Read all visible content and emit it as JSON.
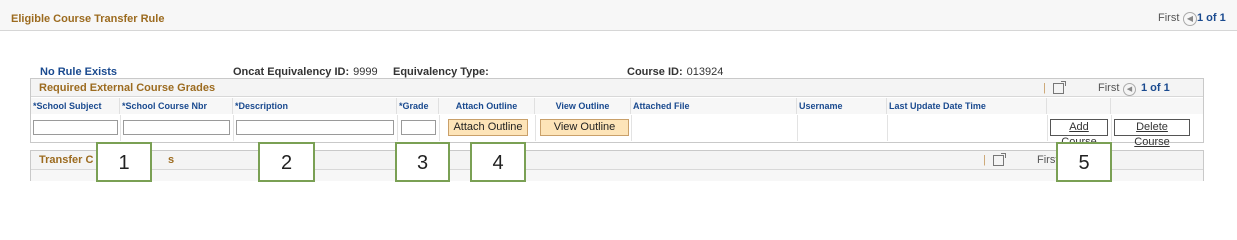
{
  "page": {
    "title": "Eligible Course Transfer Rule",
    "pager_first": "First",
    "pager_prev_icon": "circle-prev-icon",
    "pager_count": "1 of 1"
  },
  "info": {
    "no_rule": "No Rule Exists",
    "oncat_label": "Oncat Equivalency ID:",
    "oncat_value": "9999",
    "eq_type_label": "Equivalency Type:",
    "course_id_label": "Course ID:",
    "course_id_value": "013924"
  },
  "grades_grid": {
    "title": "Required External Course Grades",
    "separator": "|",
    "nav_first": "First",
    "nav_count": "1 of 1",
    "columns": [
      "*School Subject",
      "*School Course Nbr",
      "*Description",
      "*Grade",
      "Attach Outline",
      "View Outline",
      "Attached File",
      "Username",
      "Last Update Date Time"
    ],
    "row": {
      "school_subject": "",
      "school_course_nbr": "",
      "description": "",
      "grade": "",
      "attach_outline_label": "Attach Outline",
      "view_outline_label": "View Outline",
      "attached_file": "",
      "username": "",
      "last_update": "",
      "add_course_label": "Add Course",
      "delete_course_label": "Delete Course"
    }
  },
  "transfer_grid": {
    "title_left": "Transfer C",
    "title_right": "s",
    "separator": "|",
    "nav_first": "First"
  },
  "callouts": [
    "1",
    "2",
    "3",
    "4",
    "5"
  ],
  "colors": {
    "header_text": "#9c6b1f",
    "link_blue": "#1a4a8f",
    "button_fill": "#fde4b8",
    "callout_border": "#7aa054"
  }
}
